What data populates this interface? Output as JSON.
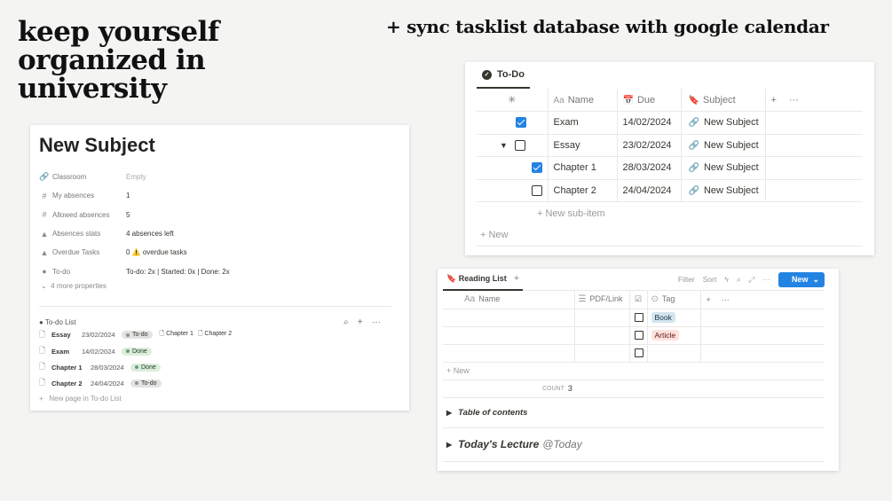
{
  "headline": {
    "line1": "keep yourself",
    "line2": "organized in",
    "line3": "university",
    "sync": "+ sync tasklist database with google calendar"
  },
  "subject": {
    "title": "New Subject",
    "properties": [
      {
        "icon": "link-icon",
        "label": "Classroom",
        "value": "Empty"
      },
      {
        "icon": "hash-icon",
        "label": "My absences",
        "value": "1"
      },
      {
        "icon": "hash-icon",
        "label": "Allowed absences",
        "value": "5"
      },
      {
        "icon": "formula-icon",
        "label": "Absences stats",
        "value": "4 absences left"
      },
      {
        "icon": "formula-icon",
        "label": "Overdue Tasks",
        "value": "0 ⚠️ overdue tasks"
      },
      {
        "icon": "status-icon",
        "label": "To-do",
        "value": "To-do: 2x | Started: 0x  | Done: 2x"
      }
    ],
    "more": "4 more properties",
    "list_title": "To-do List",
    "rows": [
      {
        "name": "Essay",
        "date": "23/02/2024",
        "status": "To-do",
        "sub1": "Chapter 1",
        "sub2": "Chapter 2"
      },
      {
        "name": "Exam",
        "date": "14/02/2024",
        "status": "Done"
      },
      {
        "name": "Chapter 1",
        "date": "28/03/2024",
        "status": "Done"
      },
      {
        "name": "Chapter 2",
        "date": "24/04/2024",
        "status": "To-do"
      }
    ],
    "new_page": "New page in To-do List"
  },
  "todo": {
    "tab": "To-Do",
    "headers": {
      "name": "Name",
      "due": "Due",
      "subject": "Subject"
    },
    "rows": [
      {
        "checked": true,
        "name": "Exam",
        "due": "14/02/2024",
        "subject": "New Subject"
      },
      {
        "checked": false,
        "name": "Essay",
        "due": "23/02/2024",
        "subject": "New Subject"
      },
      {
        "checked": true,
        "name": "Chapter 1",
        "due": "28/03/2024",
        "subject": "New Subject"
      },
      {
        "checked": false,
        "name": "Chapter 2",
        "due": "24/04/2024",
        "subject": "New Subject"
      }
    ],
    "new_sub": "New sub-item",
    "new": "New"
  },
  "reading": {
    "tab": "Reading List",
    "tools": {
      "filter": "Filter",
      "sort": "Sort",
      "new_button": "New"
    },
    "headers": {
      "name": "Name",
      "pdf": "PDF/Link",
      "tag": "Tag"
    },
    "tags": [
      "Book",
      "Article"
    ],
    "new": "New",
    "count_label": "COUNT",
    "count_value": "3",
    "toc": "Table of contents",
    "lecture": "Today's Lecture",
    "mention": "@Today"
  },
  "colors": {
    "accent": "#2383e2",
    "background": "#f4f4f3"
  }
}
